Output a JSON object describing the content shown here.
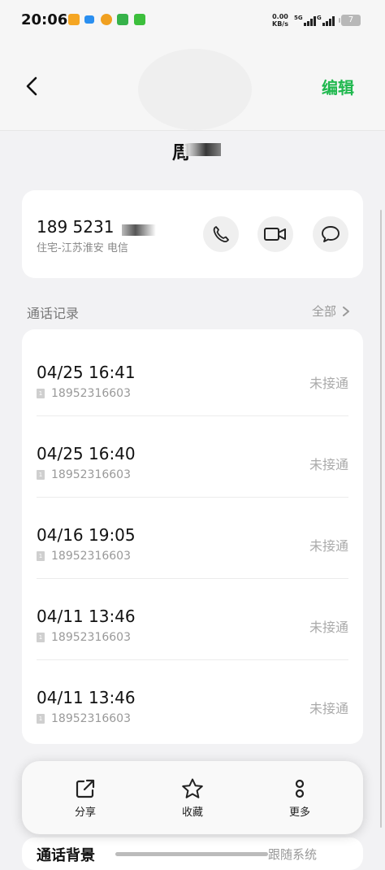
{
  "status_bar": {
    "time": "20:06",
    "net_speed_value": "0.00",
    "net_speed_unit": "KB/s",
    "signal1_label": "5G",
    "signal2_label": "G",
    "battery": "7"
  },
  "header": {
    "edit_label": "编辑",
    "contact_name": "周"
  },
  "phone": {
    "number": "189 5231 ",
    "location": "住宅-江苏淮安 电信"
  },
  "call_log": {
    "title": "通话记录",
    "all_label": "全部",
    "entries": [
      {
        "time": "04/25 16:41",
        "number": "18952316603",
        "status": "未接通"
      },
      {
        "time": "04/25 16:40",
        "number": "18952316603",
        "status": "未接通"
      },
      {
        "time": "04/16 19:05",
        "number": "18952316603",
        "status": "未接通"
      },
      {
        "time": "04/11 13:46",
        "number": "18952316603",
        "status": "未接通"
      },
      {
        "time": "04/11 13:46",
        "number": "18952316603",
        "status": "未接通"
      }
    ]
  },
  "actions": {
    "share": "分享",
    "favorite": "收藏",
    "more": "更多"
  },
  "ringback": {
    "label": "通话背景",
    "value": "跟随系统"
  },
  "colors": {
    "accent": "#1fb84e"
  }
}
